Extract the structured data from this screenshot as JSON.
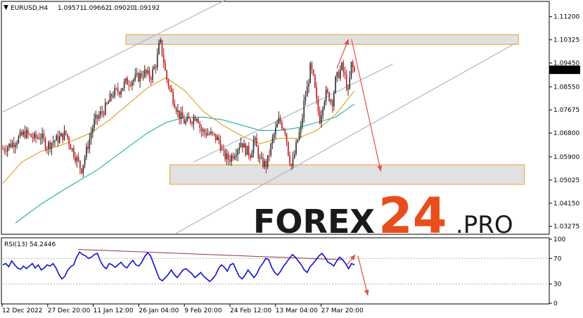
{
  "chart_data": [
    {
      "type": "candlestick",
      "symbol_label": "EURUSD,H4",
      "ohlc_label": [
        "1.09571",
        "1.09662",
        "1.09020",
        "1.09192"
      ],
      "last_price": 1.09192,
      "last_price_label": "1.09192",
      "ylim": [
        1.03,
        1.1175
      ],
      "yticks": [
        {
          "value": 1.112,
          "label": "1.11200"
        },
        {
          "value": 1.10325,
          "label": "1.10325"
        },
        {
          "value": 1.0945,
          "label": "1.09450"
        },
        {
          "value": 1.0855,
          "label": "1.08550"
        },
        {
          "value": 1.07675,
          "label": "1.07675"
        },
        {
          "value": 1.068,
          "label": "1.06800"
        },
        {
          "value": 1.059,
          "label": "1.05900"
        },
        {
          "value": 1.05025,
          "label": "1.05025"
        },
        {
          "value": 1.0415,
          "label": "1.04150"
        },
        {
          "value": 1.03275,
          "label": "1.03275"
        }
      ],
      "xticks": [
        "12 Dec 2022",
        "27 Dec 20:00",
        "11 Jan 12:00",
        "26 Jan 04:00",
        "9 Feb 20:00",
        "24 Feb 12:00",
        "13 Mar 04:00",
        "27 Mar 20:00"
      ],
      "price_path": [
        [
          0,
          1.062
        ],
        [
          3,
          1.064
        ],
        [
          7,
          1.068
        ],
        [
          10,
          1.066
        ],
        [
          12,
          1.067
        ],
        [
          14,
          1.063
        ],
        [
          16,
          1.065
        ],
        [
          18,
          1.066
        ],
        [
          20,
          1.068
        ],
        [
          22,
          1.062
        ],
        [
          24,
          1.057
        ],
        [
          25,
          1.054
        ],
        [
          27,
          1.063
        ],
        [
          29,
          1.072
        ],
        [
          31,
          1.075
        ],
        [
          33,
          1.078
        ],
        [
          35,
          1.083
        ],
        [
          37,
          1.084
        ],
        [
          39,
          1.087
        ],
        [
          41,
          1.088
        ],
        [
          43,
          1.089
        ],
        [
          45,
          1.091
        ],
        [
          47,
          1.089
        ],
        [
          49,
          1.095
        ],
        [
          50,
          1.103
        ],
        [
          51,
          1.097
        ],
        [
          52,
          1.089
        ],
        [
          54,
          1.082
        ],
        [
          56,
          1.075
        ],
        [
          58,
          1.072
        ],
        [
          60,
          1.073
        ],
        [
          62,
          1.075
        ],
        [
          63,
          1.069
        ],
        [
          65,
          1.068
        ],
        [
          67,
          1.067
        ],
        [
          69,
          1.065
        ],
        [
          70,
          1.06
        ],
        [
          72,
          1.058
        ],
        [
          74,
          1.061
        ],
        [
          76,
          1.065
        ],
        [
          77,
          1.062
        ],
        [
          79,
          1.06
        ],
        [
          80,
          1.066
        ],
        [
          82,
          1.057
        ],
        [
          84,
          1.056
        ],
        [
          86,
          1.066
        ],
        [
          88,
          1.073
        ],
        [
          90,
          1.069
        ],
        [
          91,
          1.06
        ],
        [
          92,
          1.055
        ],
        [
          94,
          1.066
        ],
        [
          95,
          1.07
        ],
        [
          96,
          1.08
        ],
        [
          97,
          1.085
        ],
        [
          98,
          1.093
        ],
        [
          99,
          1.088
        ],
        [
          100,
          1.079
        ],
        [
          101,
          1.073
        ],
        [
          102,
          1.08
        ],
        [
          103,
          1.083
        ],
        [
          105,
          1.08
        ],
        [
          106,
          1.088
        ],
        [
          108,
          1.093
        ],
        [
          109,
          1.089
        ],
        [
          110,
          1.083
        ],
        [
          111,
          1.094
        ],
        [
          112,
          1.091
        ]
      ],
      "ma_fast_path": [
        [
          0,
          1.049
        ],
        [
          6,
          1.057
        ],
        [
          12,
          1.061
        ],
        [
          20,
          1.064
        ],
        [
          28,
          1.068
        ],
        [
          34,
          1.073
        ],
        [
          40,
          1.079
        ],
        [
          46,
          1.085
        ],
        [
          52,
          1.089
        ],
        [
          58,
          1.084
        ],
        [
          64,
          1.076
        ],
        [
          70,
          1.071
        ],
        [
          76,
          1.067
        ],
        [
          82,
          1.064
        ],
        [
          88,
          1.066
        ],
        [
          94,
          1.066
        ],
        [
          100,
          1.069
        ],
        [
          106,
          1.075
        ],
        [
          112,
          1.084
        ]
      ],
      "ma_slow_path": [
        [
          4,
          1.034
        ],
        [
          12,
          1.041
        ],
        [
          20,
          1.047
        ],
        [
          30,
          1.054
        ],
        [
          38,
          1.061
        ],
        [
          46,
          1.068
        ],
        [
          52,
          1.072
        ],
        [
          58,
          1.074
        ],
        [
          64,
          1.074
        ],
        [
          70,
          1.073
        ],
        [
          76,
          1.071
        ],
        [
          82,
          1.069
        ],
        [
          88,
          1.069
        ],
        [
          94,
          1.07
        ],
        [
          100,
          1.072
        ],
        [
          106,
          1.074
        ],
        [
          112,
          1.079
        ]
      ],
      "n_bars": 120,
      "zones": [
        {
          "x0": 42,
          "x1": 176,
          "y0": 1.1015,
          "y1": 1.1052,
          "name": "resistance zone"
        },
        {
          "x0": 57,
          "x1": 178,
          "y0": 1.0486,
          "y1": 1.056,
          "name": "support zone"
        }
      ],
      "channel_lines": [
        {
          "p1": [
            0,
            1.076
          ],
          "p2": [
            79,
            1.12
          ]
        },
        {
          "p1": [
            65,
            1.057
          ],
          "p2": [
            133,
            1.094
          ]
        },
        {
          "p1": [
            59,
            1.03
          ],
          "p2": [
            175,
            1.102
          ]
        }
      ],
      "forecast_arrows": [
        {
          "from": [
            114,
            1.0925
          ],
          "to": [
            118,
            1.1035
          ]
        },
        {
          "from": [
            119,
            1.1035
          ],
          "to": [
            129,
            1.0535
          ]
        }
      ],
      "watermark": {
        "brand": "FOREX",
        "number": "24",
        "suffix": ".PRO"
      }
    },
    {
      "type": "line",
      "title": "RSI(13) 54.2446",
      "ylim": [
        0,
        100
      ],
      "yticks": [
        "100",
        "70",
        "30",
        "0"
      ],
      "levels": [
        70,
        30
      ],
      "series": [
        {
          "values": [
            60,
            62,
            57,
            66,
            60,
            55,
            53,
            58,
            54,
            58,
            62,
            55,
            60,
            52,
            55,
            60,
            58,
            62,
            55,
            45,
            38,
            42,
            52,
            57,
            60,
            72,
            80,
            76,
            74,
            70,
            72,
            76,
            78,
            66,
            58,
            54,
            62,
            60,
            56,
            60,
            64,
            58,
            55,
            62,
            67,
            60,
            58,
            64,
            73,
            79,
            74,
            62,
            50,
            38,
            35,
            40,
            45,
            52,
            45,
            40,
            46,
            52,
            54,
            50,
            46,
            40,
            44,
            48,
            42,
            38,
            34,
            38,
            44,
            54,
            60,
            56,
            50,
            60,
            62,
            52,
            42,
            38,
            44,
            52,
            46,
            40,
            46,
            56,
            62,
            70,
            68,
            56,
            48,
            44,
            50,
            58,
            64,
            70,
            76,
            72,
            66,
            60,
            52,
            48,
            57,
            62,
            68,
            74,
            78,
            72,
            64,
            62,
            58,
            66,
            72,
            68,
            62,
            54,
            62,
            60
          ]
        }
      ],
      "trendline": {
        "p1": [
          30,
          84
        ],
        "p2": [
          135,
          68
        ]
      },
      "forecast_arrows": [
        {
          "from": [
            115,
            58
          ],
          "to": [
            119,
            76
          ]
        },
        {
          "from": [
            120,
            74
          ],
          "to": [
            124,
            12
          ]
        }
      ]
    }
  ]
}
